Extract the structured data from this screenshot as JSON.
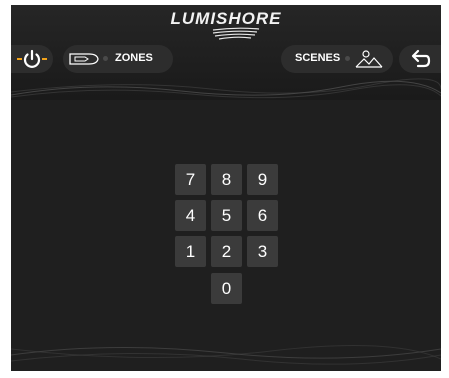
{
  "header": {
    "logo_text": "LUMISHORE",
    "zones_label": "ZONES",
    "scenes_label": "SCENES"
  },
  "keypad": {
    "keys": [
      "7",
      "8",
      "9",
      "4",
      "5",
      "6",
      "1",
      "2",
      "3",
      "0"
    ]
  },
  "colors": {
    "accent": "#f2a31b",
    "background": "#1f1f1f",
    "key": "#3b3b3b",
    "pill": "#2d2d2d"
  },
  "icons": {
    "power": "power-icon",
    "zones": "boat-icon",
    "scenes": "landscape-icon",
    "back": "back-arrow-icon"
  }
}
